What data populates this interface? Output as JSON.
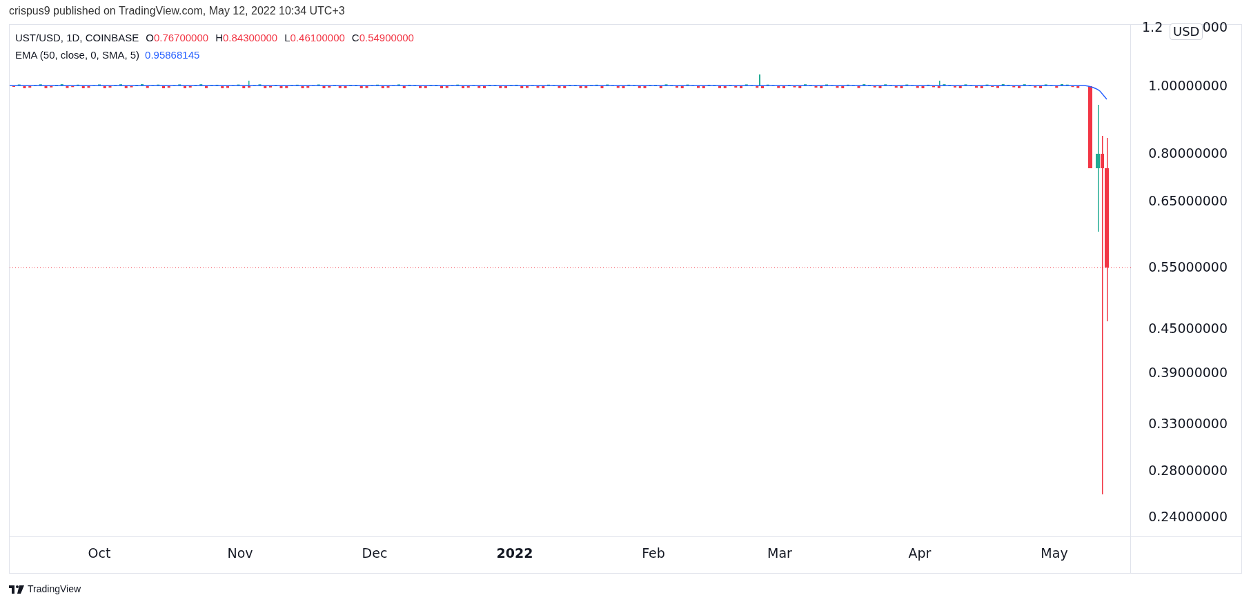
{
  "header": {
    "text": "crispus9 published on TradingView.com, May 12, 2022 10:34 UTC+3"
  },
  "legend": {
    "symbol": "UST/USD, 1D, COINBASE",
    "ohlc": [
      {
        "label": "O",
        "value": "0.76700000"
      },
      {
        "label": "H",
        "value": "0.84300000"
      },
      {
        "label": "L",
        "value": "0.46100000"
      },
      {
        "label": "C",
        "value": "0.54900000"
      }
    ],
    "indicator": {
      "name": "EMA (50, close, 0, SMA, 5)",
      "value": "0.95868145"
    }
  },
  "price_axis": {
    "top_label_parts": [
      "1.2",
      "000"
    ],
    "currency_badge": "USD",
    "labels": [
      "1.00000000",
      "0.80000000",
      "0.65000000",
      "0.55000000",
      "0.45000000",
      "0.39000000",
      "0.33000000",
      "0.28000000",
      "0.24000000"
    ]
  },
  "time_axis": [
    {
      "label": "Oct",
      "kind": "month"
    },
    {
      "label": "Nov",
      "kind": "month"
    },
    {
      "label": "Dec",
      "kind": "month"
    },
    {
      "label": "2022",
      "kind": "year"
    },
    {
      "label": "Feb",
      "kind": "month"
    },
    {
      "label": "Mar",
      "kind": "month"
    },
    {
      "label": "Apr",
      "kind": "month"
    },
    {
      "label": "May",
      "kind": "month"
    }
  ],
  "footer": {
    "brand": "TradingView"
  }
}
